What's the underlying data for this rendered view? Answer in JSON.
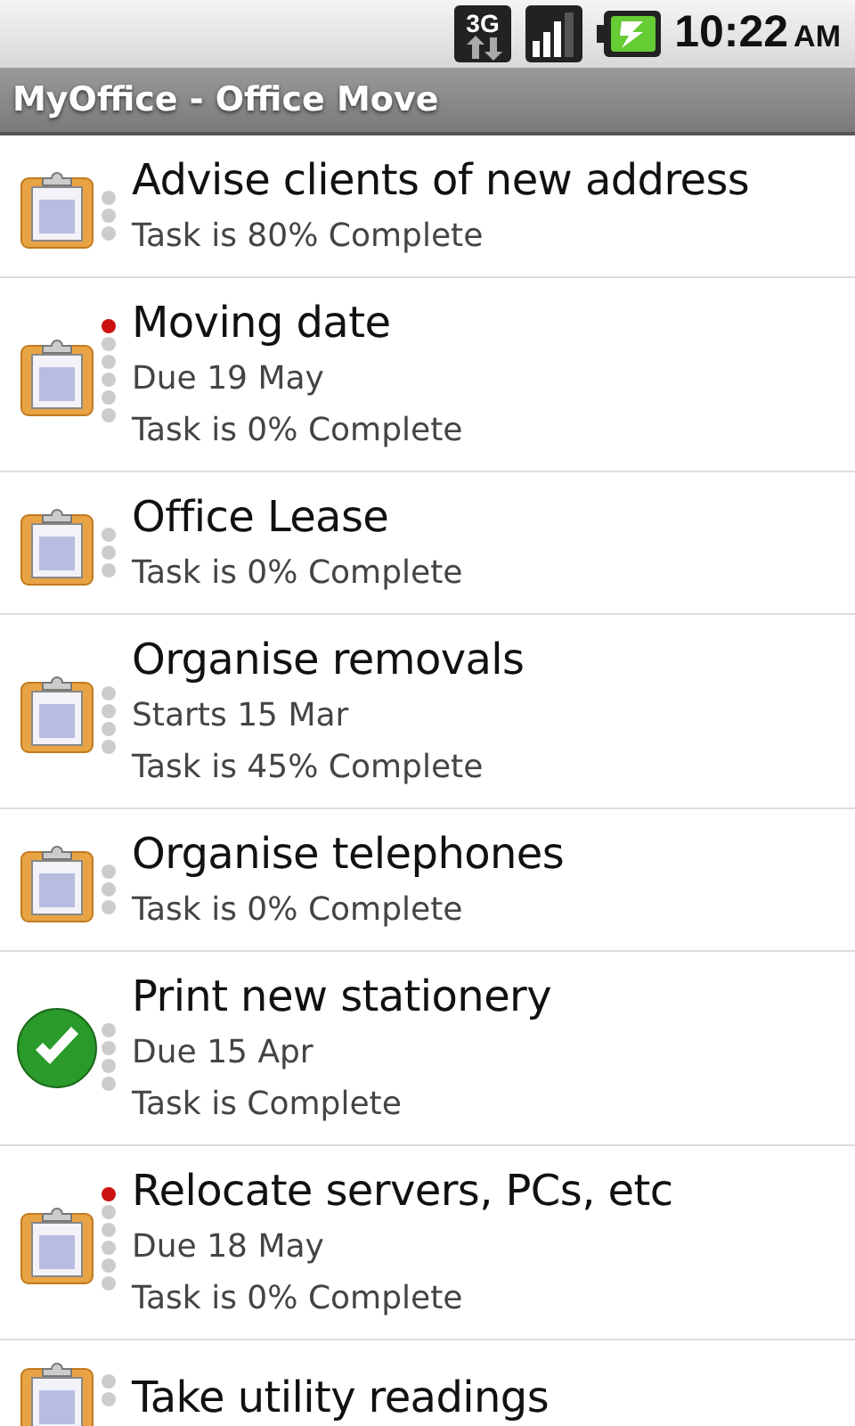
{
  "status_bar": {
    "network": "3G",
    "time": "10:22",
    "ampm": "AM"
  },
  "title_bar": {
    "title": "MyOffice - Office Move"
  },
  "tasks": [
    {
      "kind": "task",
      "flagged": false,
      "title": "Advise clients of new address",
      "lines": [
        "Task is 80% Complete"
      ]
    },
    {
      "kind": "task",
      "flagged": true,
      "title": "Moving date",
      "lines": [
        "Due 19 May",
        "Task is 0% Complete"
      ]
    },
    {
      "kind": "task",
      "flagged": false,
      "title": "Office Lease",
      "lines": [
        "Task is 0% Complete"
      ]
    },
    {
      "kind": "task",
      "flagged": false,
      "title": "Organise removals",
      "lines": [
        "Starts 15 Mar",
        "Task is 45% Complete"
      ]
    },
    {
      "kind": "task",
      "flagged": false,
      "title": "Organise telephones",
      "lines": [
        "Task is 0% Complete"
      ]
    },
    {
      "kind": "done",
      "flagged": false,
      "title": "Print new stationery",
      "lines": [
        "Due 15 Apr",
        "Task is Complete"
      ]
    },
    {
      "kind": "task",
      "flagged": true,
      "title": "Relocate servers, PCs, etc",
      "lines": [
        "Due 18 May",
        "Task is 0% Complete"
      ]
    },
    {
      "kind": "task",
      "flagged": false,
      "title": "Take utility readings"
    }
  ]
}
